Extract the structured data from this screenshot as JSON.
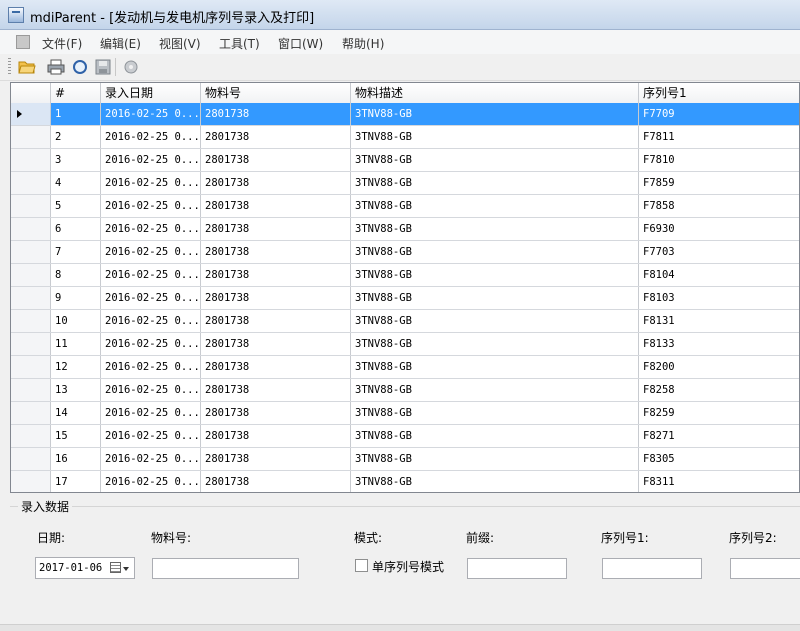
{
  "window": {
    "title": "mdiParent - [发动机与发电机序列号录入及打印]"
  },
  "menu": {
    "items": [
      "文件(F)",
      "编辑(E)",
      "视图(V)",
      "工具(T)",
      "窗口(W)",
      "帮助(H)"
    ]
  },
  "grid": {
    "columns": [
      "#",
      "录入日期",
      "物料号",
      "物料描述",
      "序列号1"
    ],
    "rows": [
      [
        "1",
        "2016-02-25 0...",
        "2801738",
        "3TNV88-GB",
        "F7709"
      ],
      [
        "2",
        "2016-02-25 0...",
        "2801738",
        "3TNV88-GB",
        "F7811"
      ],
      [
        "3",
        "2016-02-25 0...",
        "2801738",
        "3TNV88-GB",
        "F7810"
      ],
      [
        "4",
        "2016-02-25 0...",
        "2801738",
        "3TNV88-GB",
        "F7859"
      ],
      [
        "5",
        "2016-02-25 0...",
        "2801738",
        "3TNV88-GB",
        "F7858"
      ],
      [
        "6",
        "2016-02-25 0...",
        "2801738",
        "3TNV88-GB",
        "F6930"
      ],
      [
        "7",
        "2016-02-25 0...",
        "2801738",
        "3TNV88-GB",
        "F7703"
      ],
      [
        "8",
        "2016-02-25 0...",
        "2801738",
        "3TNV88-GB",
        "F8104"
      ],
      [
        "9",
        "2016-02-25 0...",
        "2801738",
        "3TNV88-GB",
        "F8103"
      ],
      [
        "10",
        "2016-02-25 0...",
        "2801738",
        "3TNV88-GB",
        "F8131"
      ],
      [
        "11",
        "2016-02-25 0...",
        "2801738",
        "3TNV88-GB",
        "F8133"
      ],
      [
        "12",
        "2016-02-25 0...",
        "2801738",
        "3TNV88-GB",
        "F8200"
      ],
      [
        "13",
        "2016-02-25 0...",
        "2801738",
        "3TNV88-GB",
        "F8258"
      ],
      [
        "14",
        "2016-02-25 0...",
        "2801738",
        "3TNV88-GB",
        "F8259"
      ],
      [
        "15",
        "2016-02-25 0...",
        "2801738",
        "3TNV88-GB",
        "F8271"
      ],
      [
        "16",
        "2016-02-25 0...",
        "2801738",
        "3TNV88-GB",
        "F8305"
      ],
      [
        "17",
        "2016-02-25 0...",
        "2801738",
        "3TNV88-GB",
        "F8311"
      ]
    ],
    "selected_row": 0
  },
  "form": {
    "group_title": "录入数据",
    "date_label": "日期:",
    "date_value": "2017-01-06",
    "part_label": "物料号:",
    "part_value": "",
    "mode_label": "模式:",
    "single_mode_label": "单序列号模式",
    "single_mode_checked": false,
    "prefix_label": "前缀:",
    "prefix_value": "",
    "serial1_label": "序列号1:",
    "serial1_value": "",
    "serial2_label": "序列号2:",
    "serial2_value": ""
  },
  "colors": {
    "selection": "#3399ff",
    "grid_border": "#828790"
  }
}
